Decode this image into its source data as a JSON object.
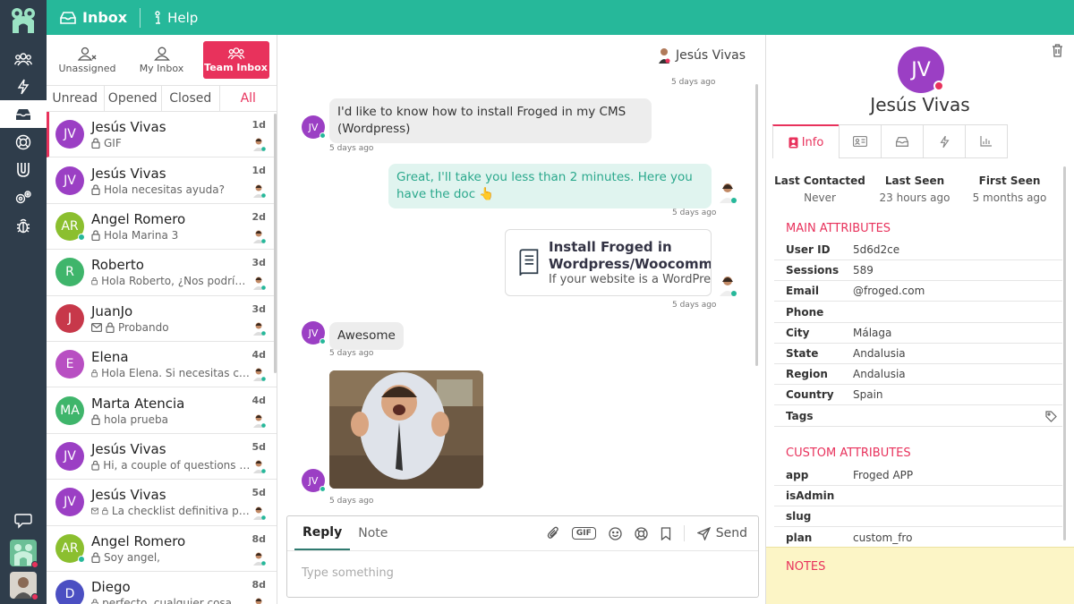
{
  "topbar": {
    "inbox_label": "Inbox",
    "help_label": "Help"
  },
  "rail": {
    "icons": [
      "logo-icon",
      "team-icon",
      "bolt-icon",
      "inbox-icon",
      "help-ring-icon",
      "magnet-icon",
      "settings-icon",
      "bug-icon"
    ],
    "chat_icon": "chat-icon"
  },
  "inbox_tabs": [
    {
      "label": "Unassigned",
      "icon": "user-x-icon"
    },
    {
      "label": "My Inbox",
      "icon": "user-icon"
    },
    {
      "label": "Team Inbox",
      "icon": "team-icon"
    }
  ],
  "filters": [
    "Unread",
    "Opened",
    "Closed",
    "All"
  ],
  "conversations": [
    {
      "initials": "JV",
      "name": "Jesús Vivas",
      "preview": "GIF",
      "time": "1d",
      "color": "#9b3fc4",
      "online": false,
      "mail": false
    },
    {
      "initials": "JV",
      "name": "Jesús Vivas",
      "preview": "Hola necesitas ayuda?",
      "time": "1d",
      "color": "#9b3fc4",
      "online": false,
      "mail": false
    },
    {
      "initials": "AR",
      "name": "Angel Romero",
      "preview": "Hola Marina 3",
      "time": "2d",
      "color": "#8bbf2f",
      "online": true,
      "mail": false
    },
    {
      "initials": "R",
      "name": "Roberto",
      "preview": "Hola Roberto, ¿Nos podrías ayudar con",
      "time": "3d",
      "color": "#3fb56b",
      "online": false,
      "mail": false
    },
    {
      "initials": "J",
      "name": "JuanJo",
      "preview": "Probando",
      "time": "3d",
      "color": "#c7384a",
      "online": false,
      "mail": true
    },
    {
      "initials": "E",
      "name": "Elena",
      "preview": "Hola Elena. Si necesitas cualquier cosa",
      "time": "4d",
      "color": "#b84fc2",
      "online": false,
      "mail": false
    },
    {
      "initials": "MA",
      "name": "Marta Atencia",
      "preview": "hola prueba",
      "time": "4d",
      "color": "#3fb56b",
      "online": false,
      "mail": false
    },
    {
      "initials": "JV",
      "name": "Jesús Vivas",
      "preview": "Hi, a couple of questions here",
      "time": "5d",
      "color": "#9b3fc4",
      "online": false,
      "mail": false
    },
    {
      "initials": "JV",
      "name": "Jesús Vivas",
      "preview": "La checklist definitiva para tu negocio",
      "time": "5d",
      "color": "#9b3fc4",
      "online": false,
      "mail": true
    },
    {
      "initials": "AR",
      "name": "Angel Romero",
      "preview": "Soy angel,",
      "time": "8d",
      "color": "#8bbf2f",
      "online": true,
      "mail": false
    },
    {
      "initials": "D",
      "name": "Diego",
      "preview": "perfecto, cualquier cosa nos dices",
      "time": "8d",
      "color": "#4b4fc2",
      "online": false,
      "mail": false
    }
  ],
  "chat": {
    "contact_name": "Jesús Vivas",
    "top_time": "5 days ago",
    "msg1": {
      "text": "I'd like to know how to install Froged in my CMS (Wordpress)",
      "time": "5 days ago",
      "initials": "JV"
    },
    "msg2": {
      "text": "Great, I'll take you less than 2 minutes. Here you have the doc 👆",
      "time": "5 days ago"
    },
    "card": {
      "title": "Install Froged in Wordpress/Woocommerce",
      "subtitle": "If your website is a WordPress",
      "time": "5 days ago"
    },
    "msg3": {
      "text": "Awesome",
      "time": "5 days ago",
      "initials": "JV"
    },
    "gif": {
      "time": "5 days ago",
      "initials": "JV"
    }
  },
  "composer": {
    "tab_reply": "Reply",
    "tab_note": "Note",
    "gif_label": "GIF",
    "send_label": "Send",
    "placeholder": "Type something"
  },
  "profile": {
    "initials": "JV",
    "name": "Jesús Vivas",
    "info_tab": "Info",
    "stats": [
      {
        "label": "Last Contacted",
        "value": "Never"
      },
      {
        "label": "Last Seen",
        "value": "23 hours ago"
      },
      {
        "label": "First Seen",
        "value": "5 months ago"
      }
    ],
    "main_title": "MAIN ATTRIBUTES",
    "main_attrs": [
      {
        "key": "User ID",
        "value": "5d6d2ce"
      },
      {
        "key": "Sessions",
        "value": "589"
      },
      {
        "key": "Email",
        "value": "        @froged.com"
      },
      {
        "key": "Phone",
        "value": ""
      },
      {
        "key": "City",
        "value": "Málaga"
      },
      {
        "key": "State",
        "value": "Andalusia"
      },
      {
        "key": "Region",
        "value": "Andalusia"
      },
      {
        "key": "Country",
        "value": "Spain"
      },
      {
        "key": "Tags",
        "value": ""
      }
    ],
    "custom_title": "CUSTOM ATTRIBUTES",
    "custom_attrs": [
      {
        "key": "app",
        "value": "Froged APP"
      },
      {
        "key": "isAdmin",
        "value": ""
      },
      {
        "key": "slug",
        "value": ""
      },
      {
        "key": "plan",
        "value": "custom_fro"
      }
    ],
    "notes_title": "NOTES"
  },
  "colors": {
    "accent": "#26b89a",
    "brand": "#e8325c",
    "rail": "#2f3d4b"
  }
}
